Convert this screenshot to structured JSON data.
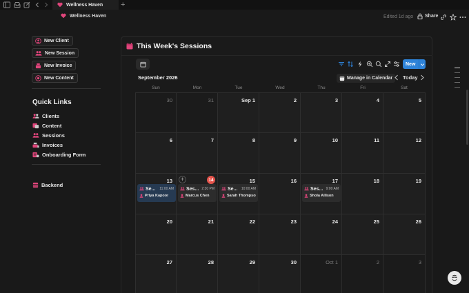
{
  "tab": {
    "title": "Wellness Haven"
  },
  "topbar": {
    "breadcrumb": "Wellness Haven",
    "edited": "Edited 1d ago",
    "share_label": "Share"
  },
  "sidebar": {
    "buttons": [
      {
        "label": "New Client",
        "icon": "person-plus-icon"
      },
      {
        "label": "New Session",
        "icon": "people-icon"
      },
      {
        "label": "New Invoice",
        "icon": "cash-register-icon"
      },
      {
        "label": "New Content",
        "icon": "target-icon"
      }
    ],
    "quick_links_title": "Quick Links",
    "quick_links": [
      {
        "label": "Clients",
        "icon": "people-icon"
      },
      {
        "label": "Content",
        "icon": "palette-icon"
      },
      {
        "label": "Sessions",
        "icon": "people-icon"
      },
      {
        "label": "Invoices",
        "icon": "cash-register-icon"
      },
      {
        "label": "Onboarding Form",
        "icon": "form-icon"
      }
    ],
    "backend": {
      "label": "Backend",
      "icon": "database-icon"
    }
  },
  "calendar": {
    "title": "This Week's Sessions",
    "month": "September 2026",
    "manage_label": "Manage in Calendar",
    "today_label": "Today",
    "new_label": "New",
    "weekdays": [
      "Sun",
      "Mon",
      "Tue",
      "Wed",
      "Thu",
      "Fri",
      "Sat"
    ],
    "weeks": [
      [
        {
          "d": "30",
          "out": true
        },
        {
          "d": "31",
          "out": true
        },
        {
          "d": "Sep 1"
        },
        {
          "d": "2"
        },
        {
          "d": "3"
        },
        {
          "d": "4"
        },
        {
          "d": "5"
        }
      ],
      [
        {
          "d": "6"
        },
        {
          "d": "7"
        },
        {
          "d": "8"
        },
        {
          "d": "9"
        },
        {
          "d": "10"
        },
        {
          "d": "11"
        },
        {
          "d": "12"
        }
      ],
      [
        {
          "d": "13"
        },
        {
          "d": "14",
          "today": true
        },
        {
          "d": "15"
        },
        {
          "d": "16"
        },
        {
          "d": "17"
        },
        {
          "d": "18"
        },
        {
          "d": "19"
        }
      ],
      [
        {
          "d": "20"
        },
        {
          "d": "21"
        },
        {
          "d": "22"
        },
        {
          "d": "23"
        },
        {
          "d": "24"
        },
        {
          "d": "25"
        },
        {
          "d": "26"
        }
      ],
      [
        {
          "d": "27"
        },
        {
          "d": "28"
        },
        {
          "d": "29"
        },
        {
          "d": "30"
        },
        {
          "d": "Oct 1",
          "out": true
        },
        {
          "d": "2",
          "out": true
        },
        {
          "d": "3",
          "out": true
        }
      ]
    ],
    "events": [
      {
        "week": 2,
        "day": 0,
        "title": "Se...",
        "time": "11:00 AM",
        "client": "Priya Kapoor",
        "selected": true
      },
      {
        "week": 2,
        "day": 1,
        "title": "Ses...",
        "time": "2:30 PM",
        "client": "Marcus Chen"
      },
      {
        "week": 2,
        "day": 2,
        "title": "Se...",
        "time": "10:00 AM",
        "client": "Sarah Thompson"
      },
      {
        "week": 2,
        "day": 4,
        "title": "Ses...",
        "time": "9:00 AM",
        "client": "Shola Allison"
      }
    ]
  },
  "colors": {
    "accent": "#2e83d9",
    "brand_pink": "#e0457b",
    "today": "#e5534b"
  }
}
